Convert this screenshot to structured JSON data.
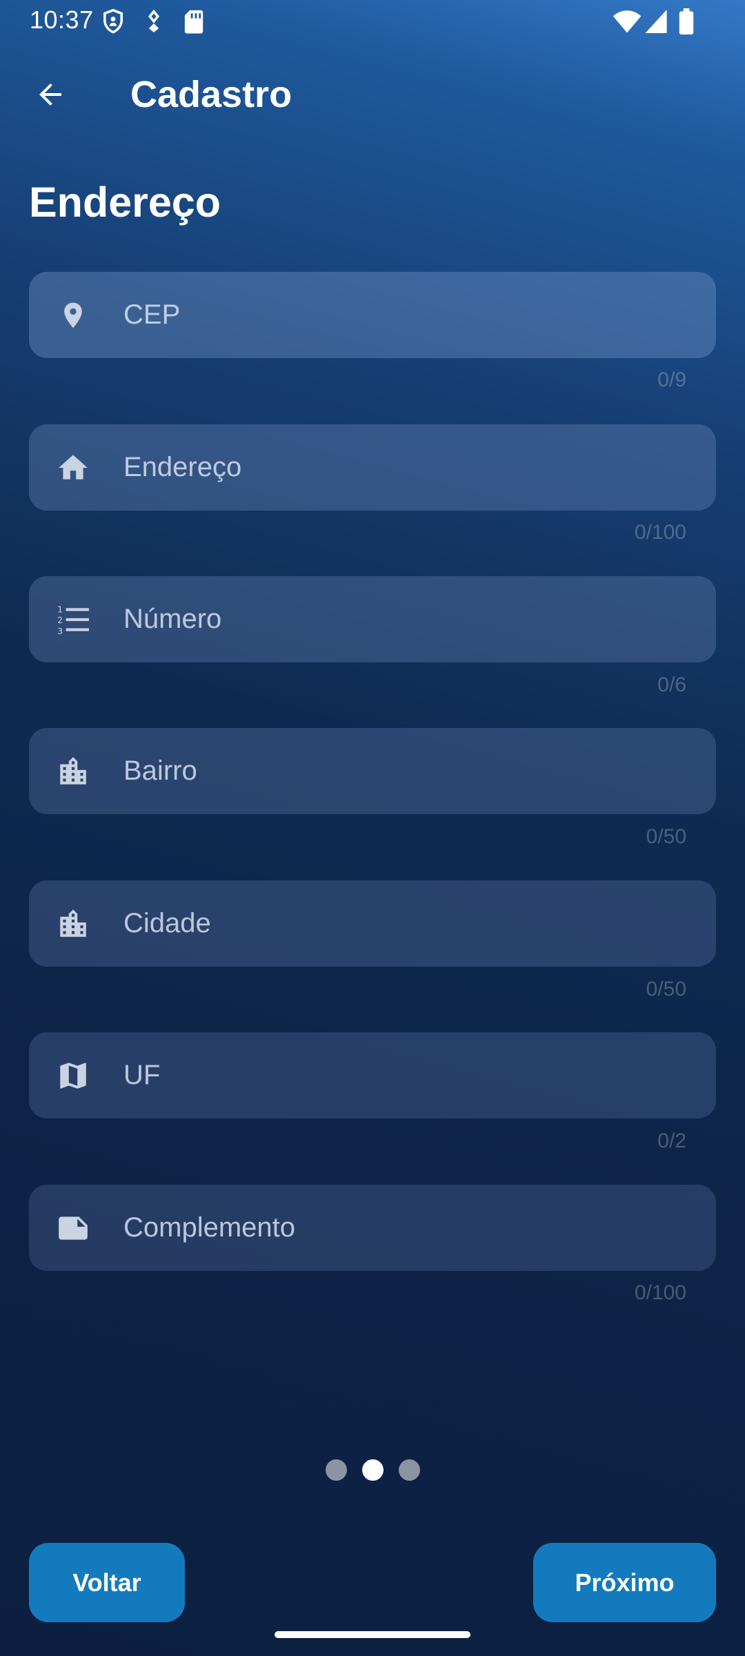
{
  "status_bar": {
    "time": "10:37",
    "icons": [
      "shield-icon",
      "location-pin-small-icon",
      "sd-card-icon",
      "wifi-icon",
      "signal-icon",
      "battery-icon"
    ]
  },
  "app_bar": {
    "title": "Cadastro",
    "back_icon": "arrow-back-icon"
  },
  "section": {
    "title": "Endereço"
  },
  "fields": [
    {
      "icon": "location-icon",
      "placeholder": "CEP",
      "value": "",
      "counter": "0/9"
    },
    {
      "icon": "home-icon",
      "placeholder": "Endereço",
      "value": "",
      "counter": "0/100"
    },
    {
      "icon": "numbered-list-icon",
      "placeholder": "Número",
      "value": "",
      "counter": "0/6"
    },
    {
      "icon": "building-icon",
      "placeholder": "Bairro",
      "value": "",
      "counter": "0/50"
    },
    {
      "icon": "building-icon",
      "placeholder": "Cidade",
      "value": "",
      "counter": "0/50"
    },
    {
      "icon": "map-icon",
      "placeholder": "UF",
      "value": "",
      "counter": "0/2"
    },
    {
      "icon": "note-icon",
      "placeholder": "Complemento",
      "value": "",
      "counter": "0/100"
    }
  ],
  "pager": {
    "total": 3,
    "current": 2
  },
  "buttons": {
    "back_label": "Voltar",
    "next_label": "Próximo"
  },
  "colors": {
    "button": "#137bbd",
    "background_top": "#3479c6",
    "background_bottom": "#0c1f40"
  }
}
